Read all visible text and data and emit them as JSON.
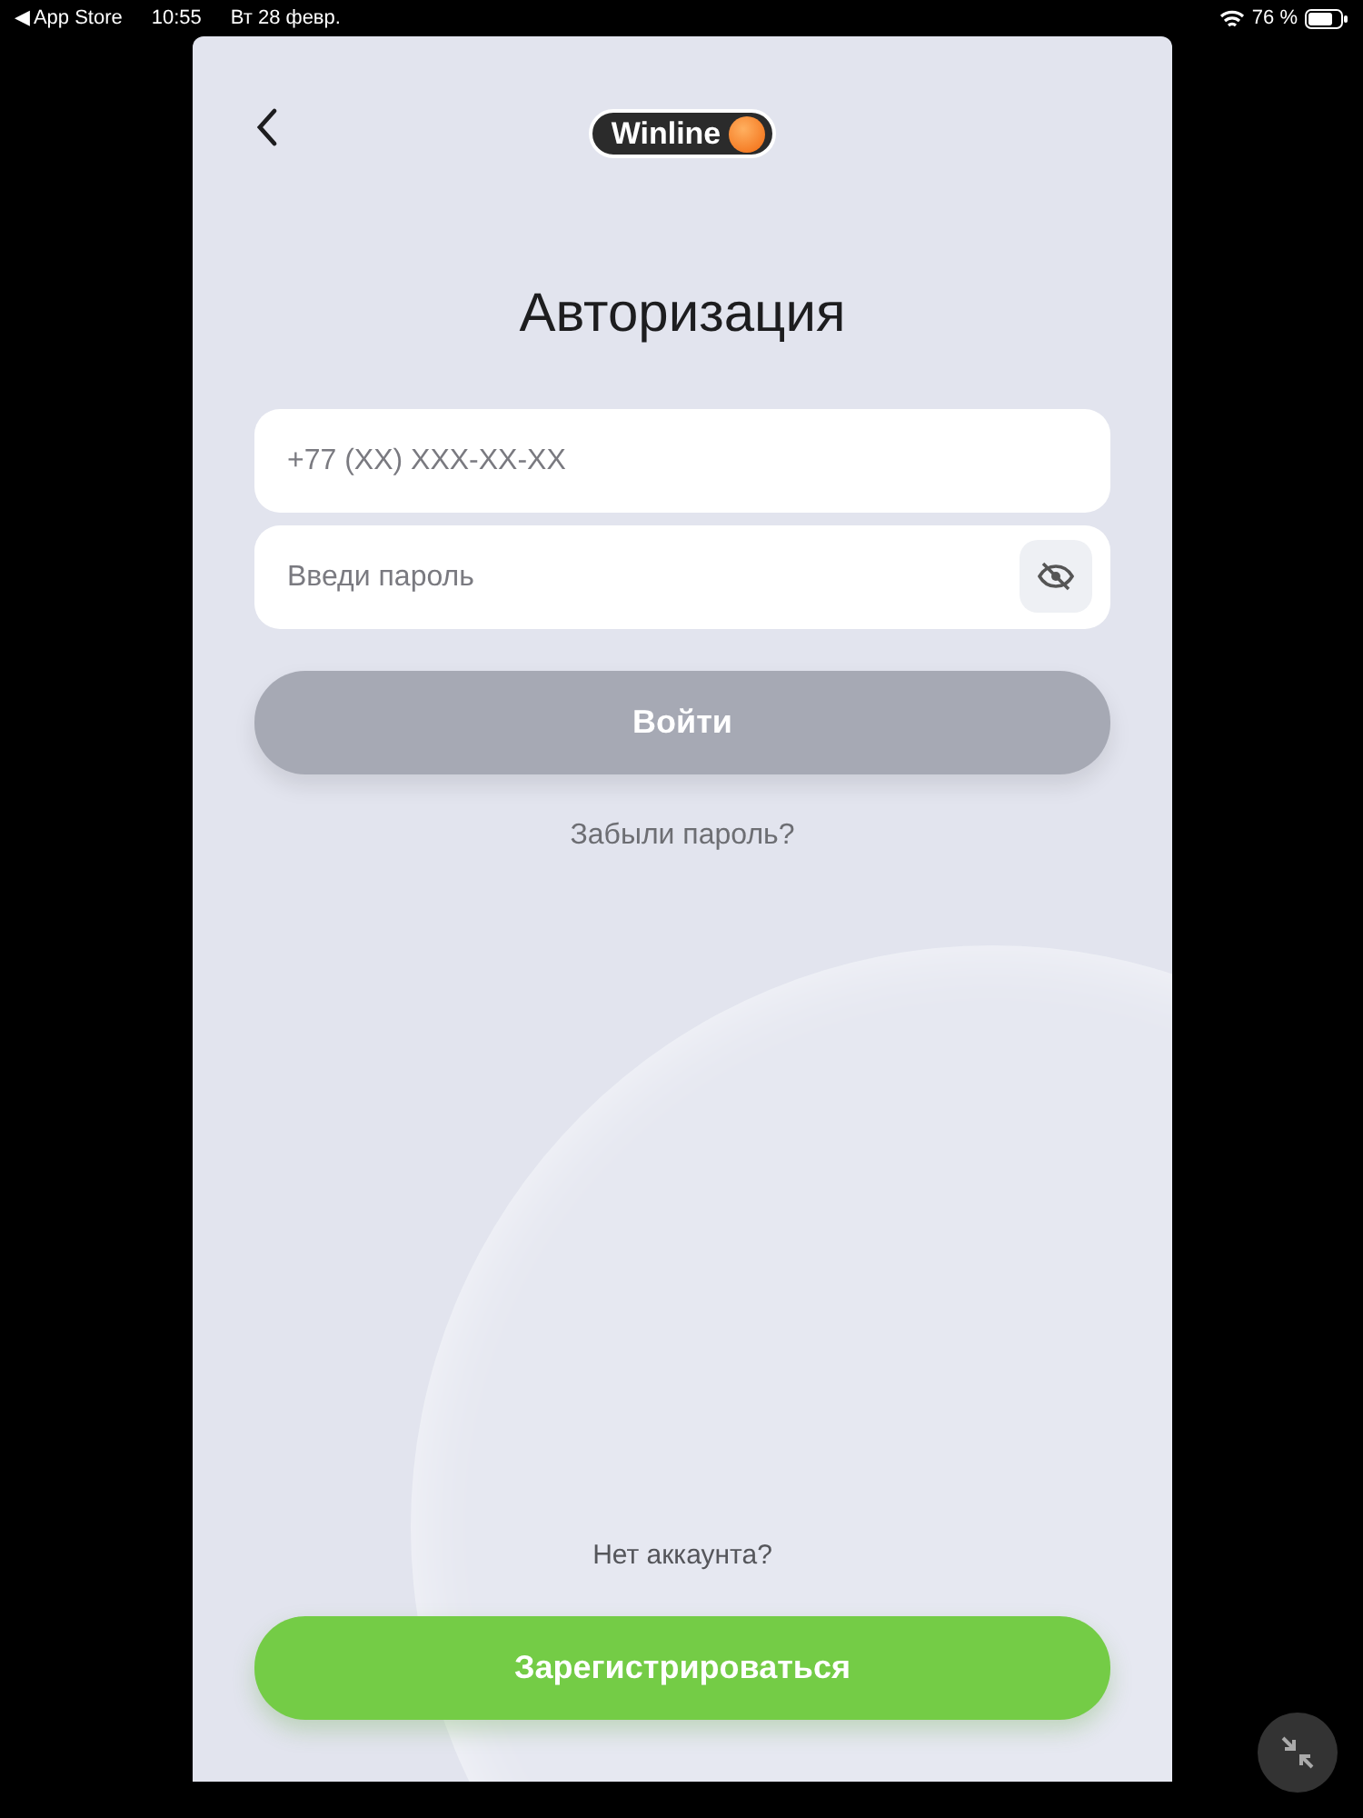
{
  "status_bar": {
    "back_app": "◀ App Store",
    "time": "10:55",
    "date": "Вт 28 февр.",
    "battery": "76 %"
  },
  "header": {
    "logo_text": "Winline"
  },
  "title": "Авторизация",
  "fields": [
    {
      "kind": "phone",
      "placeholder": "+77 (XX) XXX-XX-XX"
    },
    {
      "kind": "password",
      "placeholder": "Введи пароль"
    }
  ],
  "login_button": {
    "label": "Войти",
    "disabled": true
  },
  "forgot_link": "Забыли пароль?",
  "no_account": "Нет аккаунта?",
  "register_button": {
    "label": "Зарегистрироваться",
    "disabled": false
  }
}
